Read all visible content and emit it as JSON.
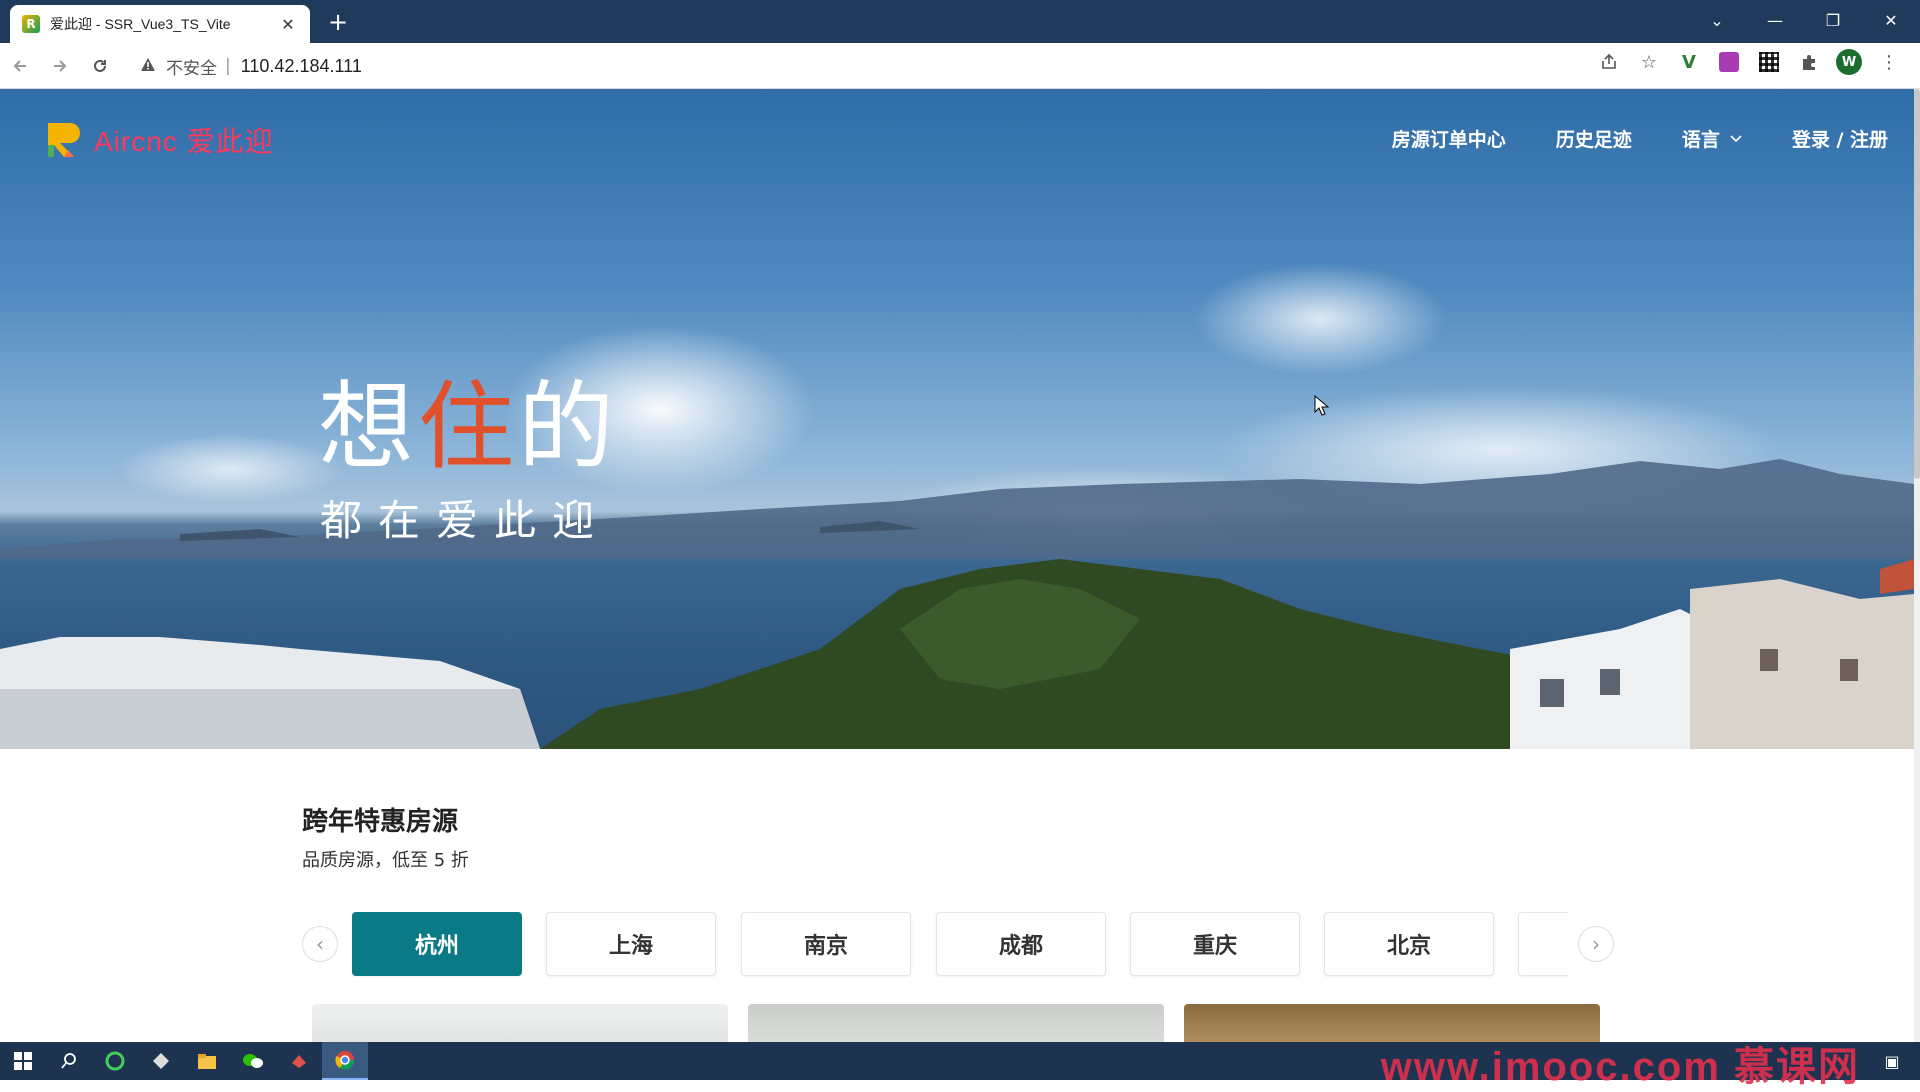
{
  "browser": {
    "tab_title": "爱此迎 - SSR_Vue3_TS_Vite",
    "tab_close": "✕",
    "new_tab": "+",
    "security_label": "不安全",
    "url": "110.42.184.111",
    "avatar_letter": "W",
    "window_controls": [
      "⌄",
      "—",
      "❐",
      "✕"
    ]
  },
  "header": {
    "logo_text": "Aircnc 爱此迎",
    "nav": [
      {
        "label": "房源订单中心"
      },
      {
        "label": "历史足迹"
      },
      {
        "label": "语言"
      },
      {
        "label": "登录 / 注册"
      }
    ]
  },
  "hero": {
    "headline_part1": "想",
    "headline_accent": "住",
    "headline_part2": "的",
    "subheadline": "都在爱此迎",
    "accent_color": "#e0502b"
  },
  "section": {
    "title": "跨年特惠房源",
    "subtitle": "品质房源，低至 5 折"
  },
  "cities": [
    {
      "label": "杭州",
      "active": true
    },
    {
      "label": "上海",
      "active": false
    },
    {
      "label": "南京",
      "active": false
    },
    {
      "label": "成都",
      "active": false
    },
    {
      "label": "重庆",
      "active": false
    },
    {
      "label": "北京",
      "active": false
    },
    {
      "label": "",
      "active": false
    }
  ],
  "city_nav": {
    "prev": "‹",
    "next": "›"
  },
  "colors": {
    "brand": "#ff385c",
    "active_city": "#0b7a87",
    "title_bar": "#1f3a5a",
    "taskbar": "#1e3350"
  },
  "taskbar": {
    "watermark": "www.imooc.com 慕课网"
  }
}
